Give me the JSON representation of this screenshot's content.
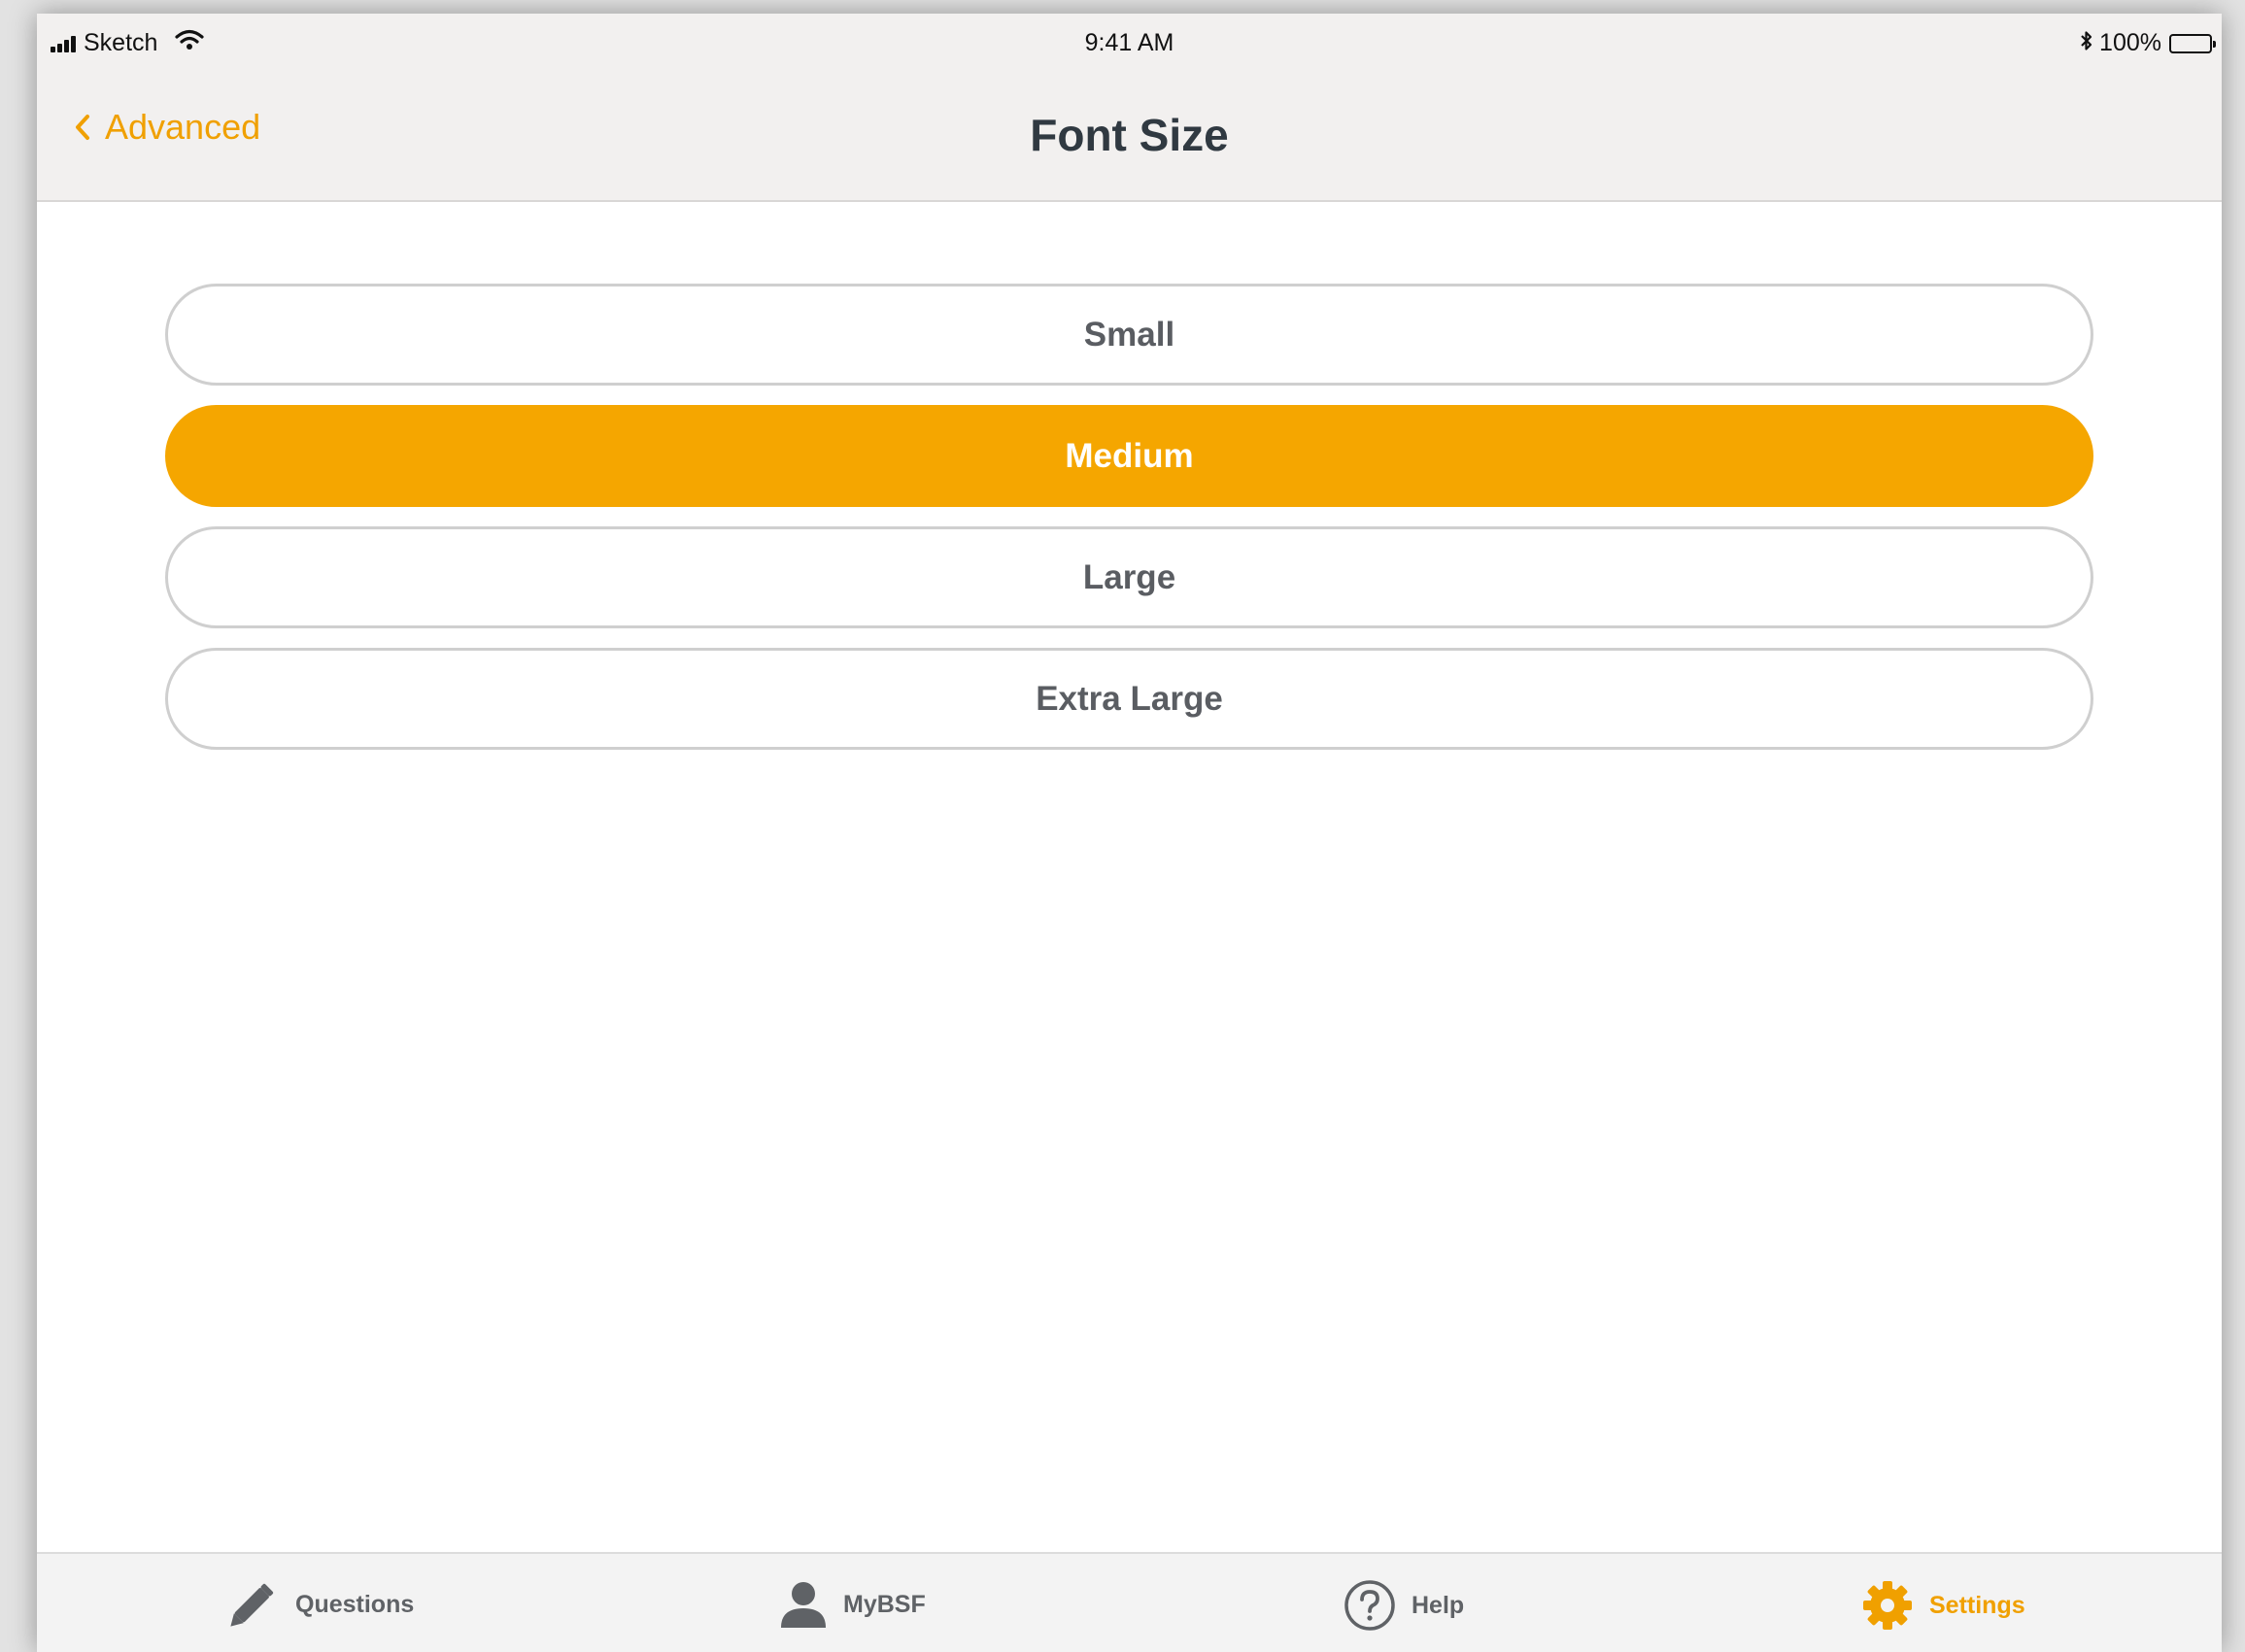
{
  "status_bar": {
    "carrier": "Sketch",
    "time": "9:41 AM",
    "battery_percent": "100%"
  },
  "nav": {
    "back_label": "Advanced",
    "title": "Font Size"
  },
  "options": [
    {
      "label": "Small",
      "selected": false
    },
    {
      "label": "Medium",
      "selected": true
    },
    {
      "label": "Large",
      "selected": false
    },
    {
      "label": "Extra Large",
      "selected": false
    }
  ],
  "tabs": [
    {
      "label": "Questions",
      "icon": "pencil-icon",
      "active": false
    },
    {
      "label": "MyBSF",
      "icon": "person-icon",
      "active": false
    },
    {
      "label": "Help",
      "icon": "help-circle-icon",
      "active": false
    },
    {
      "label": "Settings",
      "icon": "gear-icon",
      "active": true
    }
  ],
  "colors": {
    "accent": "#f5a600",
    "title_text": "#303941",
    "option_text": "#5a5d62",
    "bar_background": "#f2f0ef"
  }
}
